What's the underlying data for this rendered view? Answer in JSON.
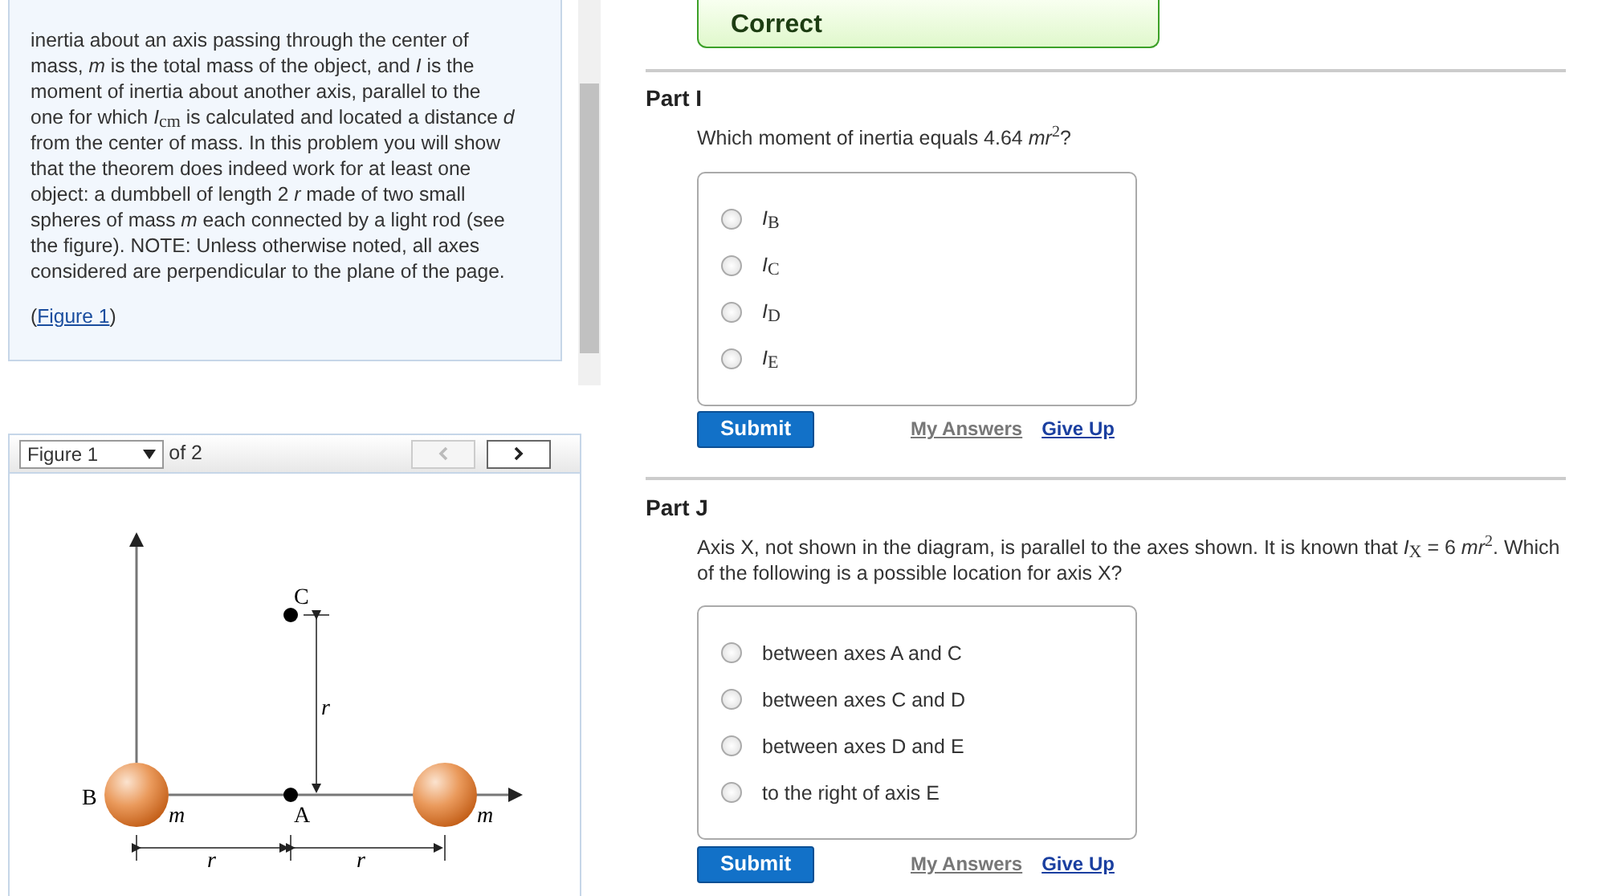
{
  "feedback": {
    "kind": "correct",
    "text": "Correct"
  },
  "problem": {
    "paragraph": "inertia about an axis passing through the center of mass, *m* is the total mass of the object, and *I* is the moment of inertia about another axis, parallel to the one for which *I*$_{cm}$ is calculated and located a distance *d* from the center of mass. In this problem you will show that the theorem does indeed work for at least one object: a dumbbell of length 2 *r* made of two small spheres of mass *m* each connected by a light rod (see the figure). NOTE: Unless otherwise noted, all axes considered are perpendicular to the plane of the page.",
    "figure_link": {
      "open": "(",
      "label": "Figure 1",
      "close": ")"
    }
  },
  "figure_viewer": {
    "select": "Figure 1",
    "count": "of 2",
    "prev_disabled": true,
    "next_disabled": false,
    "diagram_labels": [
      "C",
      "r",
      "B",
      "m",
      "A",
      "m",
      "r",
      "r"
    ]
  },
  "parts": [
    {
      "title": "Part I",
      "prompt": "Which moment of inertia equals 4.64 *mr*$^{2}$?",
      "options": [
        {
          "label": "*I*$_{B}$",
          "selected": false
        },
        {
          "label": "*I*$_{C}$",
          "selected": false
        },
        {
          "label": "*I*$_{D}$",
          "selected": false
        },
        {
          "label": "*I*$_{E}$",
          "selected": false
        }
      ],
      "submit": "Submit",
      "my_answers": "My Answers",
      "give_up": "Give Up"
    },
    {
      "title": "Part J",
      "prompt": "Axis X, not shown in the diagram, is parallel to the axes shown. It is known that *I*$_{X}$ = 6 *mr*$^{2}$. Which of the following is a possible location for axis X?",
      "options": [
        {
          "label": "between axes A and C",
          "selected": false
        },
        {
          "label": "between axes C and D",
          "selected": false
        },
        {
          "label": "between axes D and E",
          "selected": false
        },
        {
          "label": "to the right of axis E",
          "selected": false
        }
      ],
      "submit": "Submit",
      "my_answers": "My Answers",
      "give_up": "Give Up"
    }
  ]
}
